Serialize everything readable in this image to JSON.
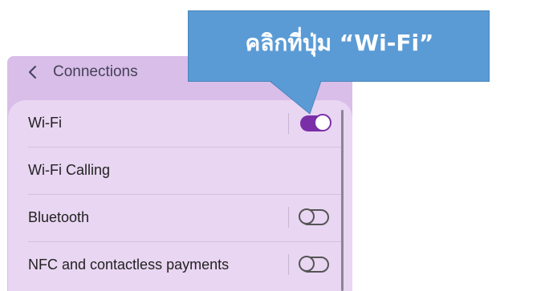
{
  "header": {
    "title": "Connections",
    "back_icon": "chevron-left-icon"
  },
  "settings": [
    {
      "label": "Wi-Fi",
      "toggle": "on"
    },
    {
      "label": "Wi-Fi Calling",
      "toggle": null
    },
    {
      "label": "Bluetooth",
      "toggle": "off"
    },
    {
      "label": "NFC and contactless payments",
      "toggle": "off"
    }
  ],
  "callout": {
    "text": "คลิกที่ปุ่ม “Wi-Fi”"
  },
  "colors": {
    "panel_background": "#d8bee8",
    "card_background": "#e9d6f2",
    "toggle_on": "#7a2fa8",
    "callout": "#5b9bd5"
  }
}
